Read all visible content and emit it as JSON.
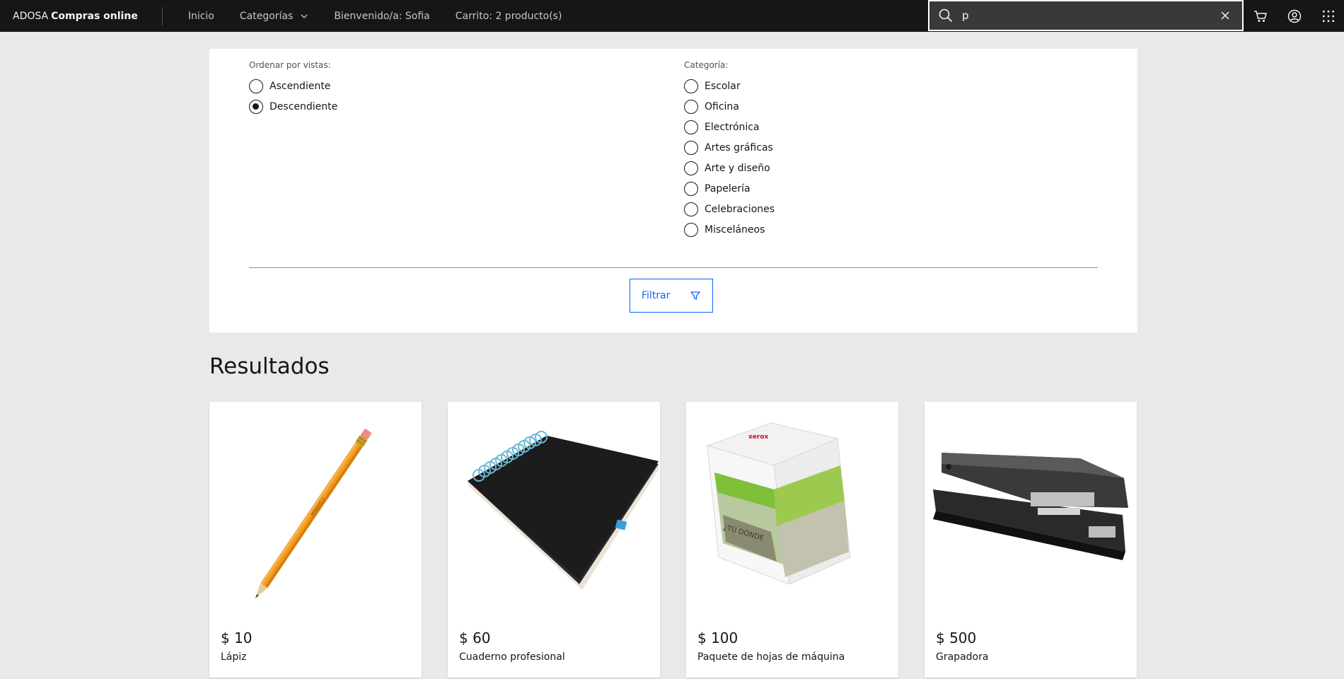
{
  "header": {
    "brand_prefix": "ADOSA",
    "brand_name": "Compras online",
    "nav": {
      "home": "Inicio",
      "categories": "Categorías",
      "welcome": "Bienvenido/a: Sofia",
      "cart": "Carrito: 2 producto(s)"
    },
    "search": {
      "value": "p"
    },
    "icons": [
      "search-icon",
      "close-icon",
      "cart-icon",
      "user-avatar-icon",
      "app-switcher-icon"
    ]
  },
  "filters": {
    "sort": {
      "legend": "Ordenar por vistas:",
      "options": [
        "Ascendiente",
        "Descendiente"
      ],
      "selected": "Descendiente"
    },
    "category": {
      "legend": "Categoría:",
      "options": [
        "Escolar",
        "Oficina",
        "Electrónica",
        "Artes gráficas",
        "Arte y diseño",
        "Papelería",
        "Celebraciones",
        "Misceláneos"
      ]
    },
    "button_label": "Filtrar"
  },
  "results": {
    "title": "Resultados",
    "products": [
      {
        "price": "$ 10",
        "name": "Lápiz"
      },
      {
        "price": "$ 60",
        "name": "Cuaderno profesional"
      },
      {
        "price": "$ 100",
        "name": "Paquete de hojas de máquina"
      },
      {
        "price": "$ 500",
        "name": "Grapadora"
      }
    ]
  },
  "colors": {
    "header_bg": "#161616",
    "page_bg": "#e9e9e9",
    "accent": "#0f62fe"
  }
}
